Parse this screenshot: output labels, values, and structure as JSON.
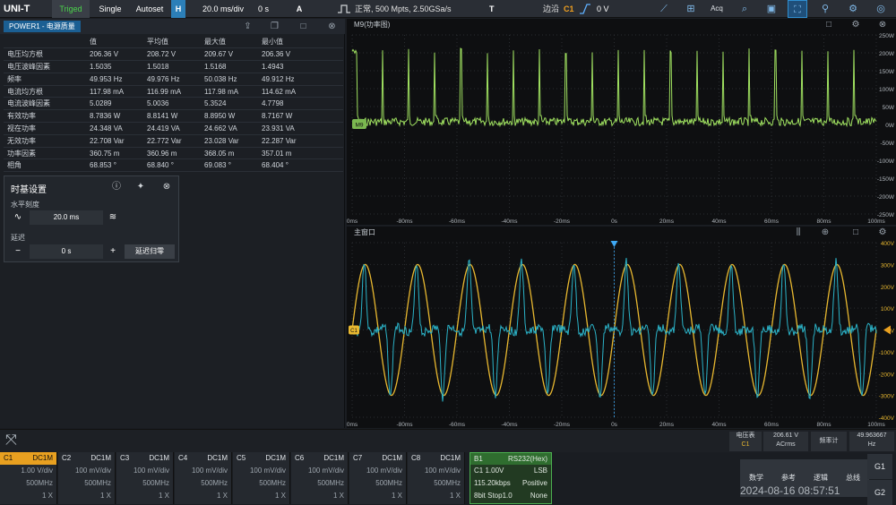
{
  "topbar": {
    "logo": "UNI-T",
    "status": "Triged",
    "single": "Single",
    "autoset": "Autoset",
    "h_badge": "H",
    "time_div": "20.0 ms/div",
    "h_offset": "0 s",
    "a_badge": "A",
    "acquisition": "正常, 500 Mpts, 2.50GSa/s",
    "t_badge": "T",
    "trigger_type": "边沿",
    "trigger_source": "C1",
    "trigger_level": "0 V",
    "acq_label": "Acq"
  },
  "measure": {
    "tab": "POWER1 - 电源质量",
    "headers": [
      "",
      "值",
      "平均值",
      "最大值",
      "最小值"
    ],
    "rows": [
      [
        "电压均方根",
        "206.36 V",
        "208.72 V",
        "209.67 V",
        "206.36 V"
      ],
      [
        "电压波峰因素",
        "1.5035",
        "1.5018",
        "1.5168",
        "1.4943"
      ],
      [
        "频率",
        "49.953 Hz",
        "49.976 Hz",
        "50.038 Hz",
        "49.912 Hz"
      ],
      [
        "电流均方根",
        "117.98 mA",
        "116.99 mA",
        "117.98 mA",
        "114.62 mA"
      ],
      [
        "电流波峰因素",
        "5.0289",
        "5.0036",
        "5.3524",
        "4.7798"
      ],
      [
        "有效功率",
        "8.7836 W",
        "8.8141 W",
        "8.8950 W",
        "8.7167 W"
      ],
      [
        "视在功率",
        "24.348 VA",
        "24.419 VA",
        "24.662 VA",
        "23.931 VA"
      ],
      [
        "无效功率",
        "22.708 Var",
        "22.772 Var",
        "23.028 Var",
        "22.287 Var"
      ],
      [
        "功率因素",
        "360.75 m",
        "360.96 m",
        "368.05 m",
        "357.01 m"
      ],
      [
        "相角",
        "68.853 °",
        "68.840 °",
        "69.083 °",
        "68.404 °"
      ]
    ]
  },
  "timebase": {
    "title": "时基设置",
    "h_scale_label": "水平刻度",
    "h_scale_value": "20.0 ms",
    "delay_label": "延迟",
    "delay_value": "0 s",
    "minus": "−",
    "plus": "+",
    "delay_zero": "延迟归零"
  },
  "math_panel": {
    "title": "M9(功率图)",
    "y_labels": [
      "250W",
      "200W",
      "150W",
      "100W",
      "50W",
      "0W",
      "-50W",
      "-100W",
      "-150W",
      "-200W",
      "-250W"
    ],
    "x_labels": [
      "0ms",
      "-80ms",
      "-60ms",
      "-40ms",
      "-20ms",
      "0s",
      "20ms",
      "40ms",
      "60ms",
      "80ms",
      "100ms"
    ],
    "marker": "M9"
  },
  "main_panel": {
    "title": "主窗口",
    "y_labels": [
      "400V",
      "300V",
      "200V",
      "100V",
      "0V",
      "-100V",
      "-200V",
      "-300V",
      "-400V"
    ],
    "x_labels": [
      "0ms",
      "-80ms",
      "-60ms",
      "-40ms",
      "-20ms",
      "0s",
      "20ms",
      "40ms",
      "60ms",
      "80ms",
      "100ms"
    ],
    "marker": "C1"
  },
  "bottom": {
    "counter_label": "电压表",
    "counter_src": "C1",
    "volt_value": "206.61 V",
    "volt_mode": "ACrms",
    "freq_label": "频率计",
    "freq_value": "49.963667",
    "freq_unit": "Hz"
  },
  "channels": [
    {
      "name": "C1",
      "coupling": "DC1M",
      "scale": "1.00 V/div",
      "bw": "500MHz",
      "probe": "1 X",
      "active": true
    },
    {
      "name": "C2",
      "coupling": "DC1M",
      "scale": "100 mV/div",
      "bw": "500MHz",
      "probe": "1 X",
      "active": false
    },
    {
      "name": "C3",
      "coupling": "DC1M",
      "scale": "100 mV/div",
      "bw": "500MHz",
      "probe": "1 X",
      "active": false
    },
    {
      "name": "C4",
      "coupling": "DC1M",
      "scale": "100 mV/div",
      "bw": "500MHz",
      "probe": "1 X",
      "active": false
    },
    {
      "name": "C5",
      "coupling": "DC1M",
      "scale": "100 mV/div",
      "bw": "500MHz",
      "probe": "1 X",
      "active": false
    },
    {
      "name": "C6",
      "coupling": "DC1M",
      "scale": "100 mV/div",
      "bw": "500MHz",
      "probe": "1 X",
      "active": false
    },
    {
      "name": "C7",
      "coupling": "DC1M",
      "scale": "100 mV/div",
      "bw": "500MHz",
      "probe": "1 X",
      "active": false
    },
    {
      "name": "C8",
      "coupling": "DC1M",
      "scale": "100 mV/div",
      "bw": "500MHz",
      "probe": "1 X",
      "active": false
    }
  ],
  "bus": {
    "name": "B1",
    "protocol": "RS232(Hex)",
    "r1_l": "C1 1.00V",
    "r1_r": "LSB",
    "r2_l": "115.20kbps",
    "r2_r": "Positive",
    "r3_l": "8bit  Stop1.0",
    "r3_r": "None"
  },
  "right_buttons": [
    "数学",
    "参考",
    "逻辑",
    "总线"
  ],
  "g_buttons": [
    "G1",
    "G2"
  ],
  "clock": "2024-08-16 08:57:51",
  "colors": {
    "ch1": "#e8b830",
    "ch2": "#2bb3c8",
    "math": "#9fe060",
    "active_tab": "#1b5f93"
  }
}
